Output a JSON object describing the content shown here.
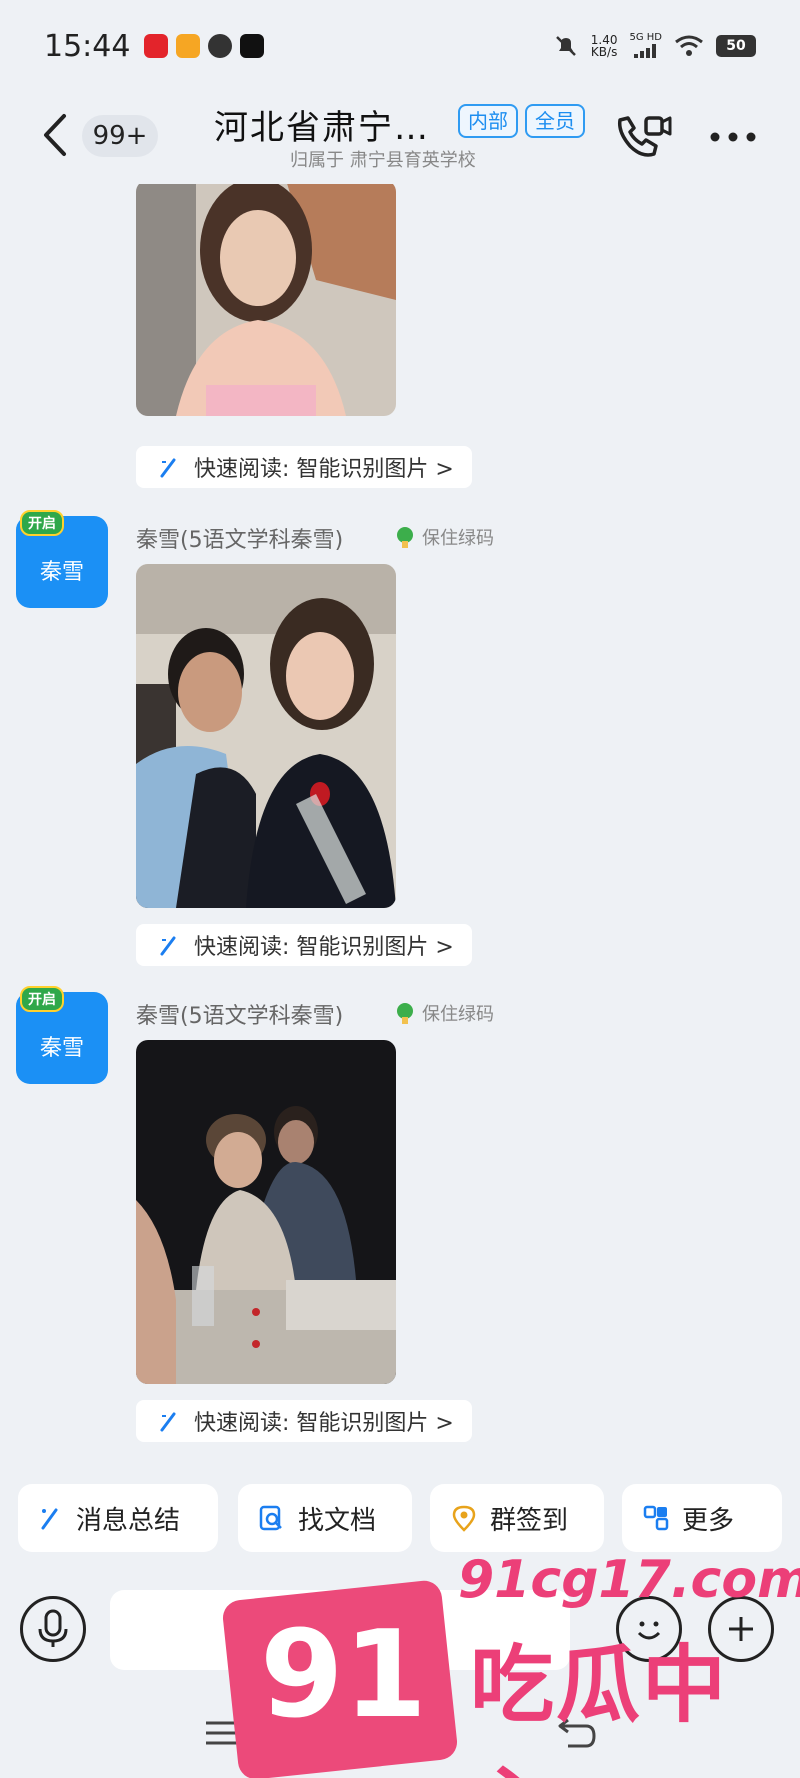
{
  "status_bar": {
    "time": "15:44",
    "net_speed": "1.40",
    "net_unit": "KB/s",
    "net_type": "5G HD",
    "battery": "50"
  },
  "header": {
    "unread": "99+",
    "title": "河北省肃宁…",
    "subtitle": "归属于 肃宁县育英学校",
    "tags": [
      "内部",
      "全员"
    ]
  },
  "messages": [
    {
      "quick_read": "快速阅读: 智能识别图片 >"
    },
    {
      "avatar_text": "秦雪",
      "avatar_crown": "开启",
      "sender": "秦雪(5语文学科秦雪)",
      "badge": "保住绿码",
      "quick_read": "快速阅读: 智能识别图片 >"
    },
    {
      "avatar_text": "秦雪",
      "avatar_crown": "开启",
      "sender": "秦雪(5语文学科秦雪)",
      "badge": "保住绿码",
      "quick_read": "快速阅读: 智能识别图片 >"
    }
  ],
  "quick_actions": [
    {
      "label": "消息总结",
      "icon": "sparkle-icon"
    },
    {
      "label": "找文档",
      "icon": "doc-search-icon"
    },
    {
      "label": "群签到",
      "icon": "location-pin-icon"
    },
    {
      "label": "更多",
      "icon": "more-apps-icon"
    }
  ],
  "input": {
    "placeholder": ""
  },
  "watermark": {
    "number": "91",
    "url": "91cg17.com",
    "text": "吃瓜中心"
  },
  "colors": {
    "accent": "#1b90f5",
    "watermark": "#ec3f78",
    "background": "#eef1f5"
  }
}
